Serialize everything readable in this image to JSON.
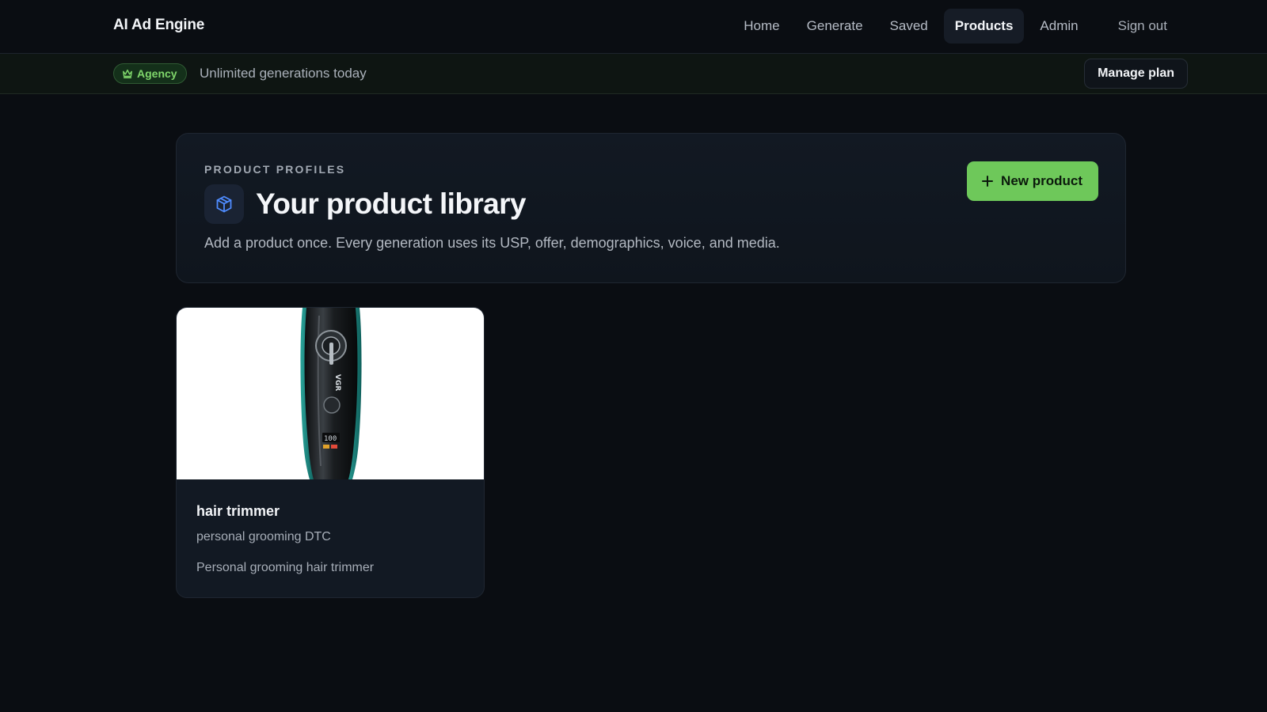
{
  "app": {
    "brand": "AI Ad Engine"
  },
  "nav": {
    "items": [
      {
        "label": "Home"
      },
      {
        "label": "Generate"
      },
      {
        "label": "Saved"
      },
      {
        "label": "Products",
        "active": true
      },
      {
        "label": "Admin"
      }
    ],
    "signout_label": "Sign out"
  },
  "plan": {
    "badge_label": "Agency",
    "status_text": "Unlimited generations today",
    "manage_label": "Manage plan"
  },
  "header": {
    "eyebrow": "PRODUCT PROFILES",
    "title": "Your product library",
    "subtitle": "Add a product once. Every generation uses its USP, offer, demographics, voice, and media.",
    "new_button_label": "New product",
    "icon": "cube-icon"
  },
  "products": [
    {
      "name": "hair trimmer",
      "category": "personal grooming DTC",
      "description": "Personal grooming hair trimmer",
      "image_text": "VGR",
      "display_text": "100"
    }
  ],
  "colors": {
    "background": "#0a0d12",
    "accent_green": "#6ec85a",
    "badge_green": "#7fd66b",
    "cube_blue": "#4f8cff"
  }
}
